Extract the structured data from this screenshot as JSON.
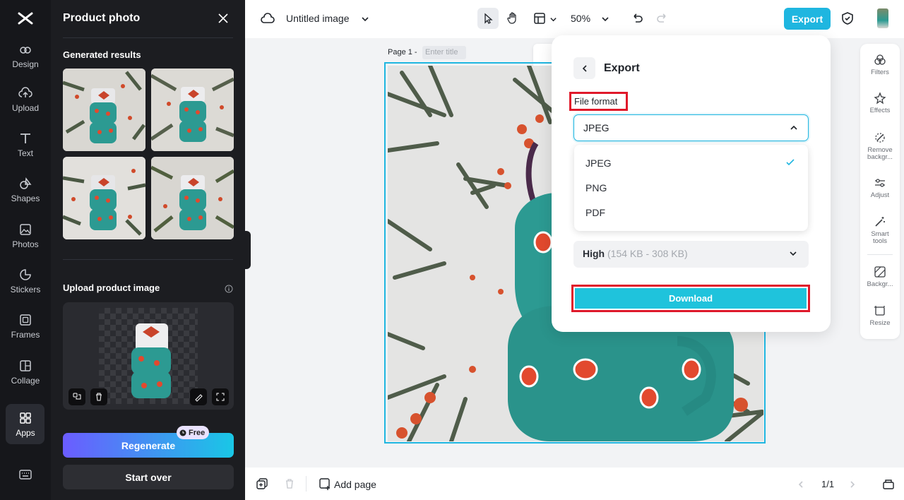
{
  "rail": {
    "items": [
      {
        "label": "Design",
        "icon": "design-icon"
      },
      {
        "label": "Upload",
        "icon": "upload-icon"
      },
      {
        "label": "Text",
        "icon": "text-icon"
      },
      {
        "label": "Shapes",
        "icon": "shapes-icon"
      },
      {
        "label": "Photos",
        "icon": "photos-icon"
      },
      {
        "label": "Stickers",
        "icon": "stickers-icon"
      },
      {
        "label": "Frames",
        "icon": "frames-icon"
      },
      {
        "label": "Collage",
        "icon": "collage-icon"
      },
      {
        "label": "Apps",
        "icon": "apps-icon"
      }
    ]
  },
  "panel": {
    "title": "Product photo",
    "generated_title": "Generated results",
    "upload_title": "Upload product image",
    "regenerate_label": "Regenerate",
    "free_badge": "Free",
    "start_over_label": "Start over"
  },
  "topbar": {
    "doc_title": "Untitled image",
    "zoom": "50%",
    "export_label": "Export"
  },
  "canvas": {
    "page_label": "Page 1 -",
    "title_placeholder": "Enter title"
  },
  "right_tools": [
    {
      "label": "Filters",
      "icon": "filters-icon"
    },
    {
      "label": "Effects",
      "icon": "effects-icon"
    },
    {
      "label": "Remove backgr...",
      "icon": "remove-background-icon"
    },
    {
      "label": "Adjust",
      "icon": "adjust-icon"
    },
    {
      "label": "Smart tools",
      "icon": "smart-tools-icon"
    },
    {
      "label": "Backgr...",
      "icon": "background-icon"
    },
    {
      "label": "Resize",
      "icon": "resize-icon"
    }
  ],
  "export_panel": {
    "title": "Export",
    "file_format_label": "File format",
    "selected_format": "JPEG",
    "options": [
      "JPEG",
      "PNG",
      "PDF"
    ],
    "quality_value": "High",
    "quality_range": "(154 KB - 308 KB)",
    "download_label": "Download"
  },
  "bottombar": {
    "add_page_label": "Add page",
    "page_count": "1/1"
  },
  "colors": {
    "accent": "#1fb6e0",
    "rail_bg": "#16171b",
    "panel_bg": "#1c1d21",
    "highlight_red": "#e0192a",
    "regenerate_gradient": [
      "#6b5cff",
      "#19c7e6"
    ],
    "cup_teal": "#2c9a92",
    "dot_red": "#e2492e"
  }
}
